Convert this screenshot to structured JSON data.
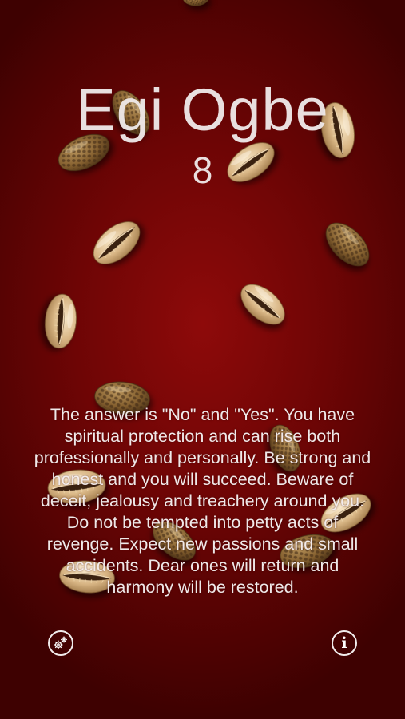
{
  "result": {
    "name": "Egi Ogbe",
    "number": "8",
    "reading": "The answer is \"No\" and \"Yes\". You have spiritual protection and can rise both professionally and personally. Be strong and honest and you will succeed. Beware of deceit, jealousy and treachery around you. Do not be tempted into petty acts of revenge. Expect new passions and small accidents. Dear ones will return and harmony will be restored."
  },
  "toolbar": {
    "settings_icon": "gears-icon",
    "info_icon": "info-icon"
  },
  "cowries": {
    "total": 16,
    "mouth_up": 8
  },
  "colors": {
    "background": "#6e0505",
    "text": "#f0ebeb",
    "shell_cream": "#d9b88a",
    "shell_brown": "#6a4a26"
  }
}
